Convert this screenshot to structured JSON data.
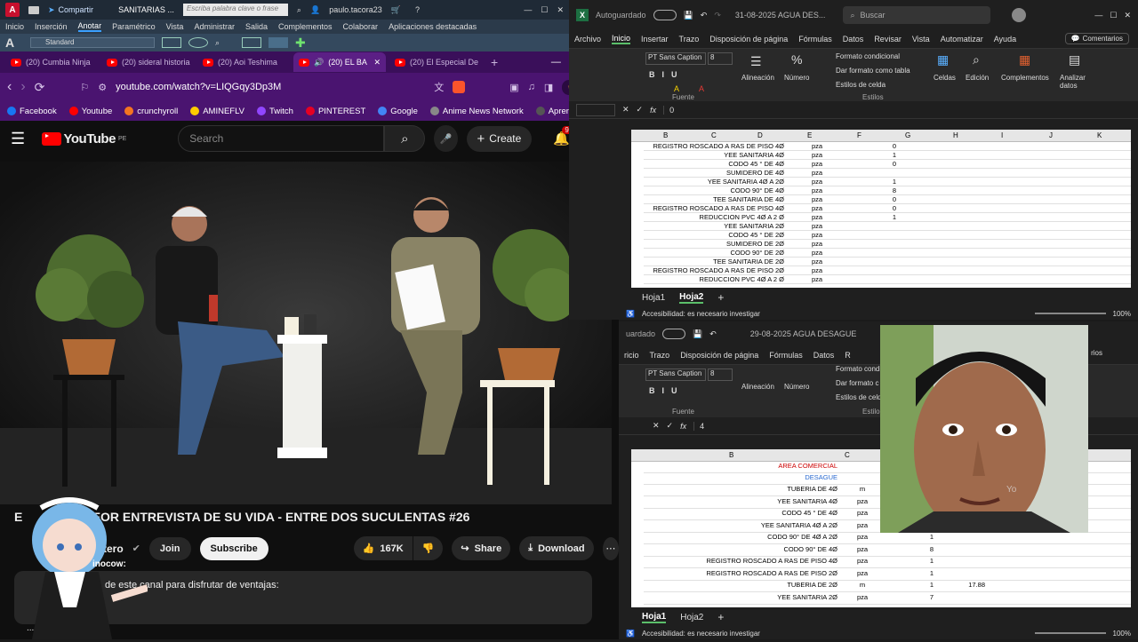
{
  "acad": {
    "title": "SANITARIAS ...",
    "search_placeholder": "Escriba palabra clave o frase",
    "user": "paulo.tacora23",
    "share": "Compartir",
    "menu": [
      "Inicio",
      "Inserción",
      "Anotar",
      "Paramétrico",
      "Vista",
      "Administrar",
      "Salida",
      "Complementos",
      "Colaborar",
      "Aplicaciones destacadas"
    ],
    "active_menu": "Anotar",
    "style_value": "Standard"
  },
  "browser": {
    "tabs": [
      "(20) Cumbia Ninja",
      "(20) sideral historia",
      "(20) Aoi Teshima",
      "(20) EL BA",
      "(20) El Especial De"
    ],
    "url": "youtube.com/watch?v=LIQGqy3Dp3M",
    "tab_count": "2",
    "bookmarks": [
      {
        "label": "Facebook",
        "color": "#1877f2"
      },
      {
        "label": "Youtube",
        "color": "#ff0000"
      },
      {
        "label": "crunchyroll",
        "color": "#f47521"
      },
      {
        "label": "AMINEFLV",
        "color": "#ffcc00"
      },
      {
        "label": "Twitch",
        "color": "#9146ff"
      },
      {
        "label": "PINTEREST",
        "color": "#e60023"
      },
      {
        "label": "Google",
        "color": "#4285f4"
      },
      {
        "label": "Anime News Network",
        "color": "#888888"
      },
      {
        "label": "Aprende",
        "color": "#555555"
      }
    ]
  },
  "youtube": {
    "logo": "YouTube",
    "country": "PE",
    "search_placeholder": "Search",
    "create": "Create",
    "notif_count": "9+",
    "video_title": "Y LA PEOR ENTREVISTA DE SU VIDA - ENTRE DOS SUCULENTAS #26",
    "title_prefix": "E",
    "channel": "tero",
    "join": "Join",
    "subscribe": "Subscribe",
    "likes": "167K",
    "share": "Share",
    "download": "Download",
    "members_text": "de este canal para disfrutar de ventajas:",
    "members_prefix": "...",
    "overlay_small": "inocow:"
  },
  "excel_top": {
    "autosave": "Autoguardado",
    "title": "31-08-2025 AGUA DES...",
    "search": "Buscar",
    "comments": "Comentarios",
    "tabs": [
      "Archivo",
      "Inicio",
      "Insertar",
      "Trazo",
      "Disposición de página",
      "Fórmulas",
      "Datos",
      "Revisar",
      "Vista",
      "Automatizar",
      "Ayuda"
    ],
    "active_tab": "Inicio",
    "font": "PT Sans Caption",
    "size": "8",
    "groups": [
      "Fuente",
      "Alineación",
      "Número",
      "Estilos",
      "Celdas",
      "Edición",
      "Complementos",
      "Analizar datos"
    ],
    "styles": [
      "Formato condicional",
      "Dar formato como tabla",
      "Estilos de celda"
    ],
    "formula_value": "0",
    "columns": [
      "B",
      "C",
      "D",
      "E",
      "F",
      "G",
      "H",
      "I",
      "J",
      "K"
    ],
    "rows": [
      {
        "desc": "REGISTRO ROSCADO  A RAS DE PISO 4Ø",
        "unit": "pza",
        "qty": "0"
      },
      {
        "desc": "YEE SANITARIA 4Ø",
        "unit": "pza",
        "qty": "1"
      },
      {
        "desc": "CODO  45 °  DE 4Ø",
        "unit": "pza",
        "qty": "0"
      },
      {
        "desc": "SUMIDERO  DE 4Ø",
        "unit": "pza",
        "qty": ""
      },
      {
        "desc": "YEE SANITARIA 4Ø A 2Ø",
        "unit": "pza",
        "qty": "1"
      },
      {
        "desc": "CODO 90°  DE 4Ø",
        "unit": "pza",
        "qty": "8"
      },
      {
        "desc": "TEE SANITARIA DE 4Ø",
        "unit": "pza",
        "qty": "0"
      },
      {
        "desc": "REGISTRO ROSCADO  A RAS DE PISO 4Ø",
        "unit": "pza",
        "qty": "0"
      },
      {
        "desc": "REDUCCION PVC 4Ø A 2 Ø",
        "unit": "pza",
        "qty": "1"
      },
      {
        "desc": "YEE SANITARIA 2Ø",
        "unit": "pza",
        "qty": ""
      },
      {
        "desc": "CODO  45 °  DE 2Ø",
        "unit": "pza",
        "qty": ""
      },
      {
        "desc": "SUMIDERO  DE 2Ø",
        "unit": "pza",
        "qty": ""
      },
      {
        "desc": "CODO 90°  DE 2Ø",
        "unit": "pza",
        "qty": ""
      },
      {
        "desc": "TEE SANITARIA DE 2Ø",
        "unit": "pza",
        "qty": ""
      },
      {
        "desc": "REGISTRO ROSCADO  A RAS DE PISO 2Ø",
        "unit": "pza",
        "qty": ""
      },
      {
        "desc": "REDUCCION PVC 4Ø A 2 Ø",
        "unit": "pza",
        "qty": ""
      }
    ],
    "sheets": [
      "Hoja1",
      "Hoja2"
    ],
    "active_sheet": "Hoja2",
    "status": "Accesibilidad: es necesario investigar",
    "zoom": "100%"
  },
  "excel_bottom": {
    "autosave": "uardado",
    "title": "29-08-2025 AGUA DESAGUE",
    "tabs": [
      "ricio",
      "Trazo",
      "Disposición de página",
      "Fórmulas",
      "Datos",
      "R"
    ],
    "comments_partial": "rios",
    "font": "PT Sans Caption",
    "size": "8",
    "groups": [
      "Fuente",
      "Alineación",
      "Número",
      "Estilo"
    ],
    "styles": [
      "Formato condic",
      "Dar formato c",
      "Estilos de celd"
    ],
    "formula_value": "4",
    "columns": [
      "B",
      "C",
      "H"
    ],
    "header_rows": [
      "AREA COMERCIAL",
      "DESAGUE"
    ],
    "rows": [
      {
        "desc": "TUBERIA DE 4Ø",
        "unit": "m",
        "qty": "",
        "extra": ""
      },
      {
        "desc": "YEE SANITARIA 4Ø",
        "unit": "pza",
        "qty": "",
        "extra": ""
      },
      {
        "desc": "CODO  45 °  DE 4Ø",
        "unit": "pza",
        "qty": "",
        "extra": ""
      },
      {
        "desc": "YEE SANITARIA 4Ø A 2Ø",
        "unit": "pza",
        "qty": "",
        "extra": ""
      },
      {
        "desc": "CODO 90° DE 4Ø A 2Ø",
        "unit": "pza",
        "qty": "1",
        "extra": ""
      },
      {
        "desc": "CODO 90°  DE 4Ø",
        "unit": "pza",
        "qty": "8",
        "extra": ""
      },
      {
        "desc": "REGISTRO ROSCADO  A RAS DE PISO 4Ø",
        "unit": "pza",
        "qty": "1",
        "extra": ""
      },
      {
        "desc": "REGISTRO ROSCADO  A RAS DE PISO 2Ø",
        "unit": "pza",
        "qty": "1",
        "extra": ""
      },
      {
        "desc": "TUBERIA DE 2Ø",
        "unit": "m",
        "qty": "1",
        "extra": "17.88"
      },
      {
        "desc": "YEE SANITARIA 2Ø",
        "unit": "pza",
        "qty": "7",
        "extra": ""
      }
    ],
    "sheets": [
      "Hoja1",
      "Hoja2"
    ],
    "active_sheet": "Hoja1",
    "status": "Accesibilidad: es necesario investigar",
    "zoom": "100%"
  },
  "webcam": {
    "watermark": "Yo"
  }
}
